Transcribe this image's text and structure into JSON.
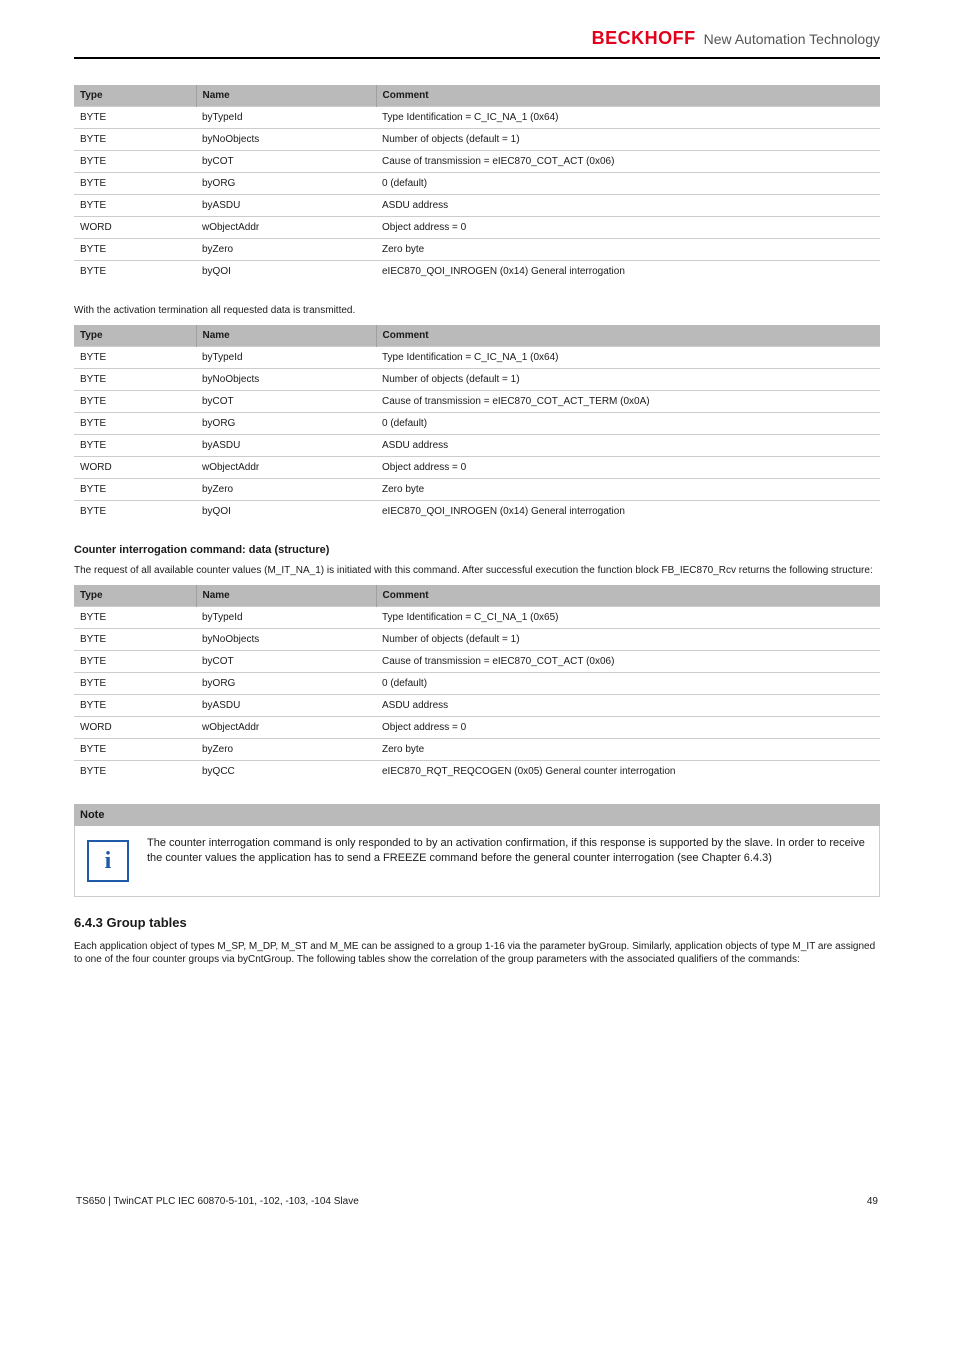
{
  "header": {
    "brand": "BECKHOFF",
    "tagline": "New Automation Technology"
  },
  "tables": [
    {
      "headers": [
        "Type",
        "Name",
        "Comment"
      ],
      "rows": [
        [
          "BYTE",
          "byTypeId",
          "Type Identification = C_IC_NA_1 (0x64)"
        ],
        [
          "BYTE",
          "byNoObjects",
          "Number of objects (default = 1)"
        ],
        [
          "BYTE",
          "byCOT",
          "Cause of transmission = eIEC870_COT_ACT (0x06)"
        ],
        [
          "BYTE",
          "byORG",
          "0 (default)"
        ],
        [
          "BYTE",
          "byASDU",
          "ASDU address"
        ],
        [
          "WORD",
          "wObjectAddr",
          "Object address = 0"
        ],
        [
          "BYTE",
          "byZero",
          "Zero byte"
        ],
        [
          "BYTE",
          "byQOI",
          "eIEC870_QOI_INROGEN (0x14)  General interrogation"
        ]
      ]
    },
    {
      "headers": [
        "Type",
        "Name",
        "Comment"
      ],
      "rows": [
        [
          "BYTE",
          "byTypeId",
          "Type Identification = C_IC_NA_1 (0x64)"
        ],
        [
          "BYTE",
          "byNoObjects",
          "Number of objects (default = 1)"
        ],
        [
          "BYTE",
          "byCOT",
          "Cause of transmission = eIEC870_COT_ACT_TERM (0x0A)"
        ],
        [
          "BYTE",
          "byORG",
          "0 (default)"
        ],
        [
          "BYTE",
          "byASDU",
          "ASDU address"
        ],
        [
          "WORD",
          "wObjectAddr",
          "Object address = 0"
        ],
        [
          "BYTE",
          "byZero",
          "Zero byte"
        ],
        [
          "BYTE",
          "byQOI",
          "eIEC870_QOI_INROGEN (0x14)  General interrogation"
        ]
      ]
    },
    {
      "headers": [
        "Type",
        "Name",
        "Comment"
      ],
      "rows": [
        [
          "BYTE",
          "byTypeId",
          "Type Identification = C_CI_NA_1 (0x65)"
        ],
        [
          "BYTE",
          "byNoObjects",
          "Number of objects (default = 1)"
        ],
        [
          "BYTE",
          "byCOT",
          "Cause of transmission = eIEC870_COT_ACT (0x06)"
        ],
        [
          "BYTE",
          "byORG",
          "0 (default)"
        ],
        [
          "BYTE",
          "byASDU",
          "ASDU address"
        ],
        [
          "WORD",
          "wObjectAddr",
          "Object address = 0"
        ],
        [
          "BYTE",
          "byZero",
          "Zero byte"
        ],
        [
          "BYTE",
          "byQCC",
          "eIEC870_RQT_REQCOGEN (0x05)  General counter interrogation"
        ]
      ]
    }
  ],
  "paragraphs": {
    "p1": "With the activation termination all requested data is transmitted.",
    "p2": "The request of all available counter values (M_IT_NA_1) is initiated with this command. After successful execution the function block FB_IEC870_Rcv returns the following structure:",
    "p3": "Each application object of types M_SP, M_DP, M_ST and M_ME can be assigned to a group 1-16 via the parameter byGroup. Similarly, application objects of type M_IT are assigned to one of the four counter groups via byCntGroup. The following tables show the correlation of the group parameters with the associated qualifiers of the commands:"
  },
  "headings": {
    "h1": "Counter interrogation command: data (structure)",
    "h2": "6.4.3 Group tables"
  },
  "note": {
    "title": "Note",
    "text": "The counter interrogation command is only responded to by an activation confirmation, if this response is supported by the slave. In order to receive the counter values the application has to send a FREEZE command before the general counter interrogation (see Chapter 6.4.3)"
  },
  "footer": {
    "left": "TS650 | TwinCAT PLC IEC 60870-5-101, -102, -103, -104 Slave",
    "right": "49"
  }
}
